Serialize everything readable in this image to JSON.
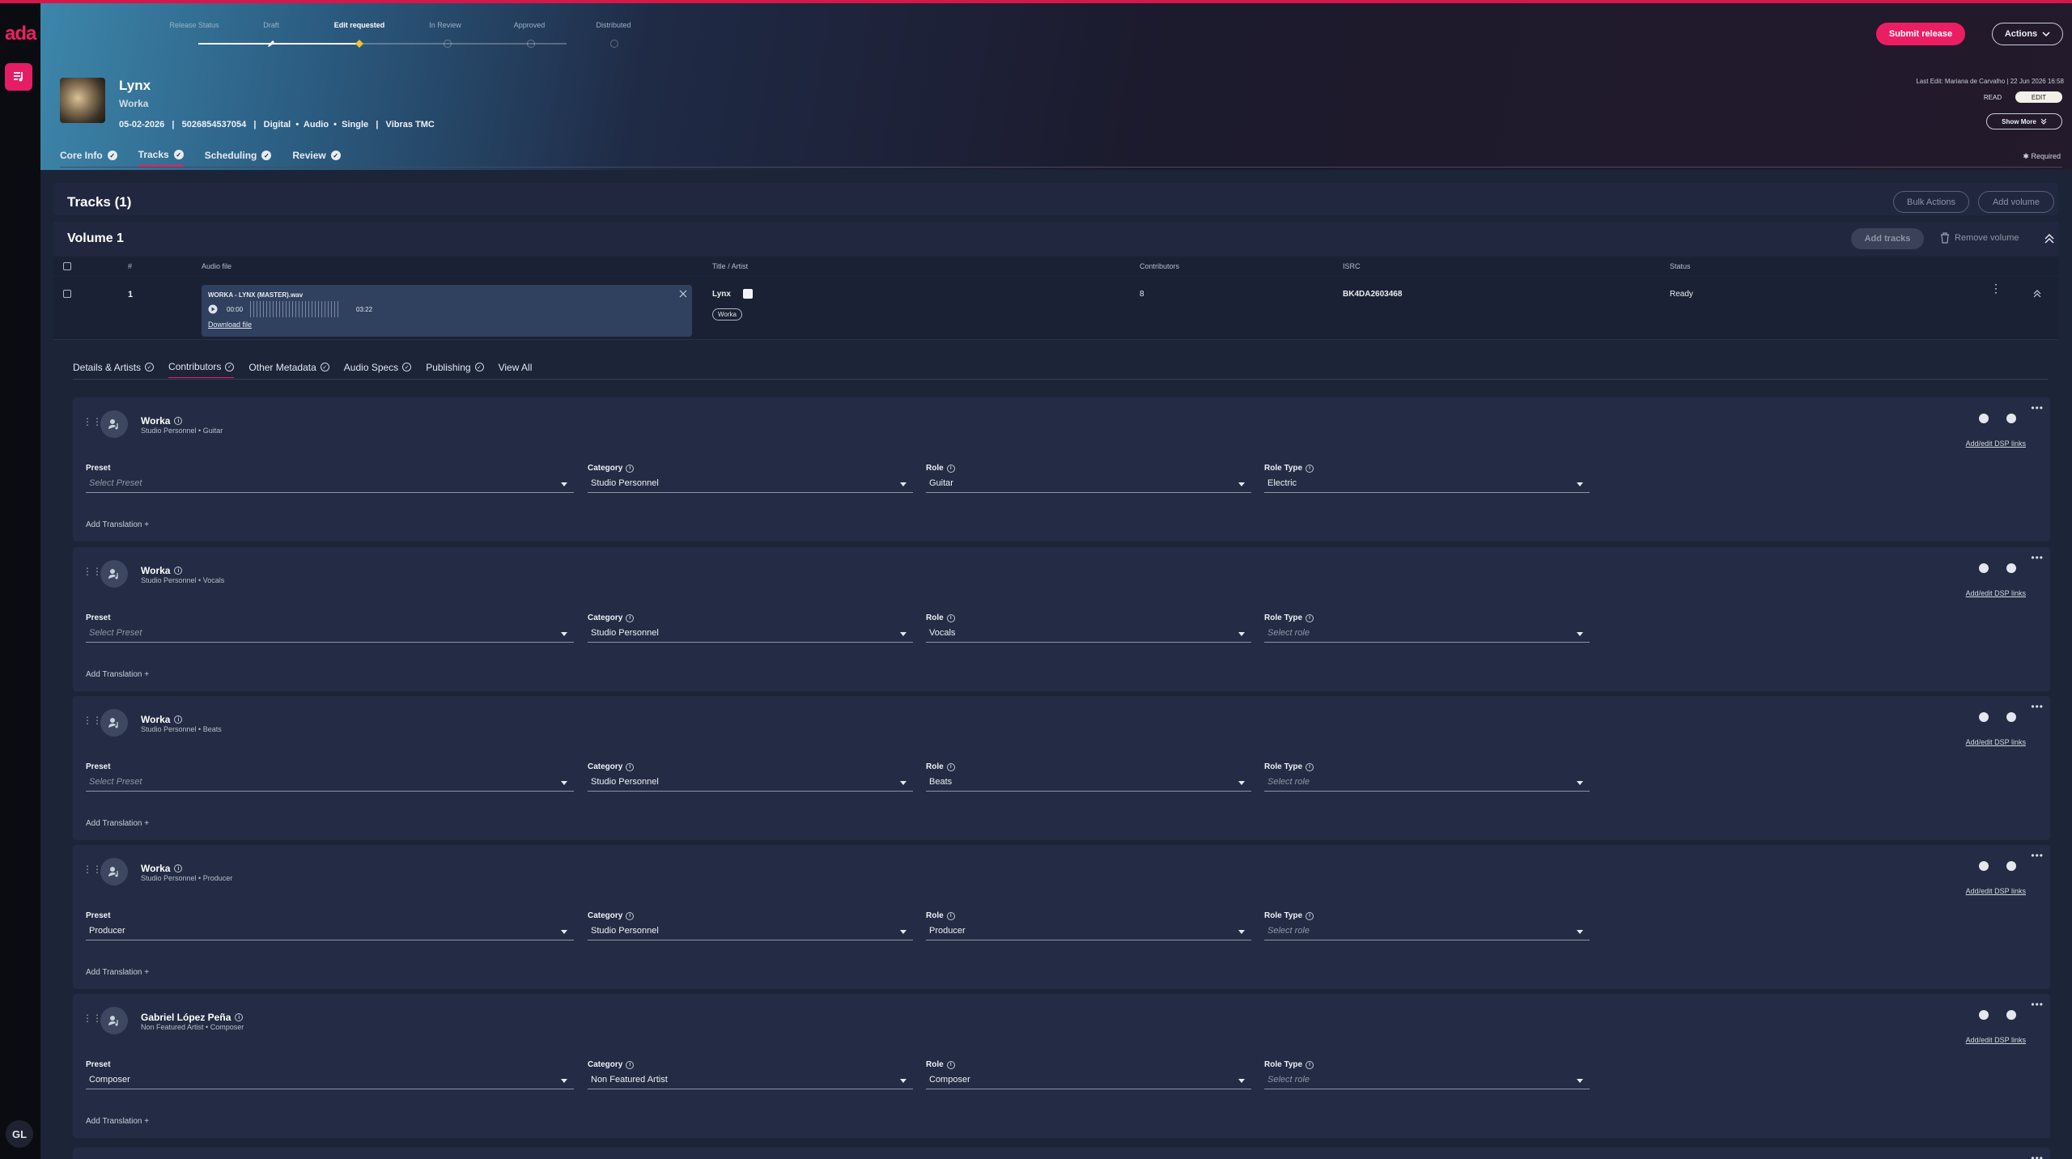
{
  "app": {
    "logo": "ada",
    "user_initials": "GL"
  },
  "stepper": {
    "steps": [
      "Release Status",
      "Draft",
      "Edit requested",
      "In Review",
      "Approved",
      "Distributed"
    ]
  },
  "header": {
    "submit_label": "Submit release",
    "actions_label": "Actions",
    "release": {
      "title": "Lynx",
      "artist": "Worka",
      "meta": "05-02-2026   |   5026854537054   |   Digital  •  Audio  •  Single   |   Vibras TMC"
    },
    "last_edit": "Last Edit: Mariana de Carvalho | 22 Jun 2026 16:58",
    "read_label": "READ",
    "edit_label": "EDIT",
    "show_more_label": "Show More"
  },
  "tabs": [
    {
      "label": "Core Info"
    },
    {
      "label": "Tracks"
    },
    {
      "label": "Scheduling"
    },
    {
      "label": "Review"
    }
  ],
  "required_label": "Required",
  "tracks": {
    "title": "Tracks (1)",
    "bulk_actions": "Bulk Actions",
    "add_volume": "Add volume"
  },
  "volume": {
    "title": "Volume 1",
    "add_tracks": "Add tracks",
    "remove_volume": "Remove volume"
  },
  "table": {
    "headers": [
      "#",
      "Audio file",
      "Title / Artist",
      "Contributors",
      "ISRC",
      "Status"
    ],
    "row": {
      "number": "1",
      "file_name": "WORKA - LYNX (MASTER).wav",
      "time_current": "00:00",
      "time_total": "03:22",
      "download": "Download file",
      "title": "Lynx",
      "artist_tag": "Worka",
      "contributors": "8",
      "isrc": "BK4DA2603468",
      "status": "Ready"
    }
  },
  "subtabs": [
    {
      "label": "Details & Artists"
    },
    {
      "label": "Contributors"
    },
    {
      "label": "Other Metadata"
    },
    {
      "label": "Audio Specs"
    },
    {
      "label": "Publishing"
    },
    {
      "label": "View All"
    }
  ],
  "field_labels": {
    "preset": "Preset",
    "category": "Category",
    "role": "Role",
    "role_type": "Role Type",
    "add_translation": "Add Translation",
    "dsp_links": "Add/edit DSP links"
  },
  "contributors": [
    {
      "name": "Worka",
      "subtitle": "Studio Personnel • Guitar",
      "preset": "Select Preset",
      "category": "Studio Personnel",
      "role": "Guitar",
      "role_type": "Electric"
    },
    {
      "name": "Worka",
      "subtitle": "Studio Personnel • Vocals",
      "preset": "Select Preset",
      "category": "Studio Personnel",
      "role": "Vocals",
      "role_type": "Select role"
    },
    {
      "name": "Worka",
      "subtitle": "Studio Personnel • Beats",
      "preset": "Select Preset",
      "category": "Studio Personnel",
      "role": "Beats",
      "role_type": "Select role"
    },
    {
      "name": "Worka",
      "subtitle": "Studio Personnel • Producer",
      "preset": "Producer",
      "category": "Studio Personnel",
      "role": "Producer",
      "role_type": "Select role"
    },
    {
      "name": "Gabriel López Peña",
      "subtitle": "Non Featured Artist • Composer",
      "preset": "Composer",
      "category": "Non Featured Artist",
      "role": "Composer",
      "role_type": "Select role"
    }
  ]
}
